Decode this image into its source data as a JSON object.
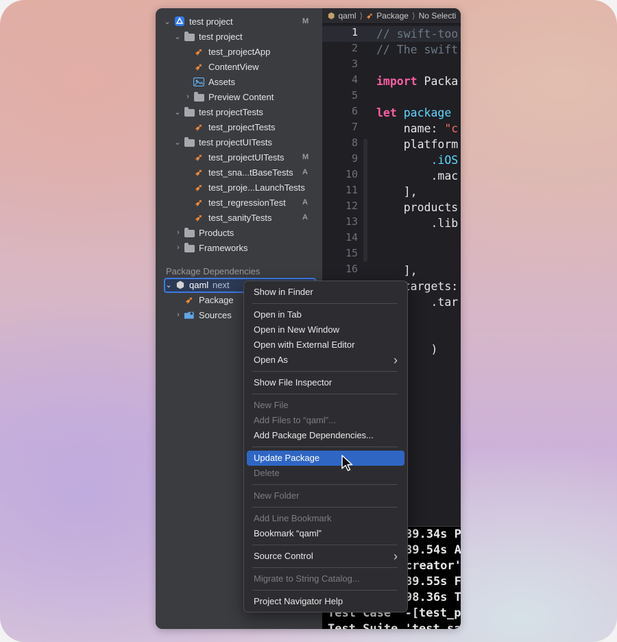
{
  "sidebar": {
    "rows": [
      {
        "label": "test project",
        "badge": "M",
        "icon": "app-project-icon"
      },
      {
        "label": "test project",
        "badge": "",
        "icon": "folder-icon"
      },
      {
        "label": "test_projectApp",
        "badge": "",
        "icon": "swift-file-icon"
      },
      {
        "label": "ContentView",
        "badge": "",
        "icon": "swift-file-icon"
      },
      {
        "label": "Assets",
        "badge": "",
        "icon": "asset-catalog-icon"
      },
      {
        "label": "Preview Content",
        "badge": "",
        "icon": "folder-icon"
      },
      {
        "label": "test projectTests",
        "badge": "",
        "icon": "folder-icon"
      },
      {
        "label": "test_projectTests",
        "badge": "",
        "icon": "swift-file-icon"
      },
      {
        "label": "test projectUITests",
        "badge": "",
        "icon": "folder-icon"
      },
      {
        "label": "test_projectUITests",
        "badge": "M",
        "icon": "swift-file-icon"
      },
      {
        "label": "test_sna...tBaseTests",
        "badge": "A",
        "icon": "swift-file-icon"
      },
      {
        "label": "test_proje...LaunchTests",
        "badge": "",
        "icon": "swift-file-icon"
      },
      {
        "label": "test_regressionTest",
        "badge": "A",
        "icon": "swift-file-icon"
      },
      {
        "label": "test_sanityTests",
        "badge": "A",
        "icon": "swift-file-icon"
      },
      {
        "label": "Products",
        "badge": "",
        "icon": "folder-icon"
      },
      {
        "label": "Frameworks",
        "badge": "",
        "icon": "folder-icon"
      }
    ],
    "section_title": "Package Dependencies",
    "package_name": "qaml",
    "package_tag": "next",
    "package_children": [
      {
        "label": "Package",
        "icon": "swift-file-icon"
      },
      {
        "label": "Sources",
        "icon": "sources-folder-icon"
      }
    ]
  },
  "editor": {
    "breadcrumb": [
      "qaml",
      "Package",
      "No Selecti"
    ],
    "line_numbers": [
      "1",
      "2",
      "3",
      "4",
      "5",
      "6",
      "7",
      "8",
      "9",
      "10",
      "11",
      "12",
      "13",
      "14",
      "15",
      "16"
    ],
    "code_lines": [
      [
        {
          "c": "cm",
          "t": "// swift-too"
        }
      ],
      [
        {
          "c": "cm",
          "t": "// The swift"
        }
      ],
      [],
      [
        {
          "c": "kw",
          "t": "import"
        },
        {
          "c": "",
          "t": " Packa"
        }
      ],
      [],
      [
        {
          "c": "kw",
          "t": "let"
        },
        {
          "c": "",
          "t": " "
        },
        {
          "c": "ty",
          "t": "package"
        },
        {
          "c": "",
          "t": " "
        }
      ],
      [
        {
          "c": "",
          "t": "    name: "
        },
        {
          "c": "st",
          "t": "\"c"
        }
      ],
      [
        {
          "c": "",
          "t": "    platform"
        }
      ],
      [
        {
          "c": "",
          "t": "        "
        },
        {
          "c": "ty",
          "t": ".iOS"
        }
      ],
      [
        {
          "c": "",
          "t": "        .mac"
        }
      ],
      [
        {
          "c": "",
          "t": "    ],"
        }
      ],
      [
        {
          "c": "",
          "t": "    products"
        }
      ],
      [
        {
          "c": "",
          "t": "        .lib"
        }
      ],
      [],
      [],
      [
        {
          "c": "",
          "t": "    ],"
        }
      ],
      [
        {
          "c": "",
          "t": "    targets:"
        }
      ],
      [
        {
          "c": "",
          "t": "        .tar"
        }
      ],
      [],
      [],
      [
        {
          "c": "",
          "t": "        )"
        }
      ],
      [
        {
          "c": "",
          "t": "    ]"
        }
      ]
    ]
  },
  "console": {
    "lines": [
      "89.34s P",
      "89.54s A",
      "creator'",
      "89.55s F",
      "98.36s T",
      "Test Case '-[test_p",
      "Test Suite 'test_sa"
    ]
  },
  "context_menu": {
    "items": [
      {
        "label": "Show in Finder",
        "disabled": false
      },
      {
        "sep": true
      },
      {
        "label": "Open in Tab",
        "disabled": false
      },
      {
        "label": "Open in New Window",
        "disabled": false
      },
      {
        "label": "Open with External Editor",
        "disabled": false
      },
      {
        "label": "Open As",
        "disabled": false,
        "submenu": true
      },
      {
        "sep": true
      },
      {
        "label": "Show File Inspector",
        "disabled": false
      },
      {
        "sep": true
      },
      {
        "label": "New File",
        "disabled": true
      },
      {
        "label": "Add Files to “qaml”...",
        "disabled": true
      },
      {
        "label": "Add Package Dependencies...",
        "disabled": false
      },
      {
        "sep": true
      },
      {
        "label": "Update Package",
        "disabled": false,
        "highlighted": true
      },
      {
        "label": "Delete",
        "disabled": true
      },
      {
        "sep": true
      },
      {
        "label": "New Folder",
        "disabled": true
      },
      {
        "sep": true
      },
      {
        "label": "Add Line Bookmark",
        "disabled": true
      },
      {
        "label": "Bookmark “qaml”",
        "disabled": false
      },
      {
        "sep": true
      },
      {
        "label": "Source Control",
        "disabled": false,
        "submenu": true
      },
      {
        "sep": true
      },
      {
        "label": "Migrate to String Catalog...",
        "disabled": true
      },
      {
        "sep": true
      },
      {
        "label": "Project Navigator Help",
        "disabled": false
      }
    ]
  },
  "colors": {
    "sidebar_bg": "#3b3c40",
    "selection": "#3d7ae4",
    "menu_highlight": "#2f66c4",
    "swift_orange": "#f08a3c"
  }
}
